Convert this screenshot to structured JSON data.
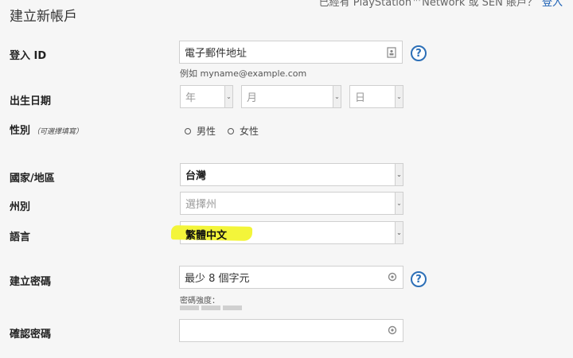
{
  "header": {
    "title": "建立新帳戶",
    "account_prompt": "已經有 PlayStation™Network 或 SEN 賬戶？",
    "login_link": "登入"
  },
  "fields": {
    "login_id": {
      "label": "登入 ID",
      "placeholder": "電子郵件地址",
      "hint": "例如 myname@example.com"
    },
    "birthdate": {
      "label": "出生日期",
      "year": "年",
      "month": "月",
      "day": "日"
    },
    "gender": {
      "label": "性別",
      "optional_note": "（可選擇填寫）",
      "options": [
        "男性",
        "女性"
      ]
    },
    "country": {
      "label": "國家/地區",
      "value": "台灣"
    },
    "state": {
      "label": "州別",
      "placeholder": "選擇州"
    },
    "language": {
      "label": "語言",
      "value": "繁體中文",
      "highlight_color": "#f3f53a"
    },
    "password": {
      "label": "建立密碼",
      "placeholder": "最少 8 個字元",
      "strength_label": "密碼強度："
    },
    "confirm_password": {
      "label": "確認密碼"
    }
  },
  "colors": {
    "background": "#f6f6f6",
    "help_icon": "#2c6fb7",
    "link": "#1a5fb4"
  }
}
